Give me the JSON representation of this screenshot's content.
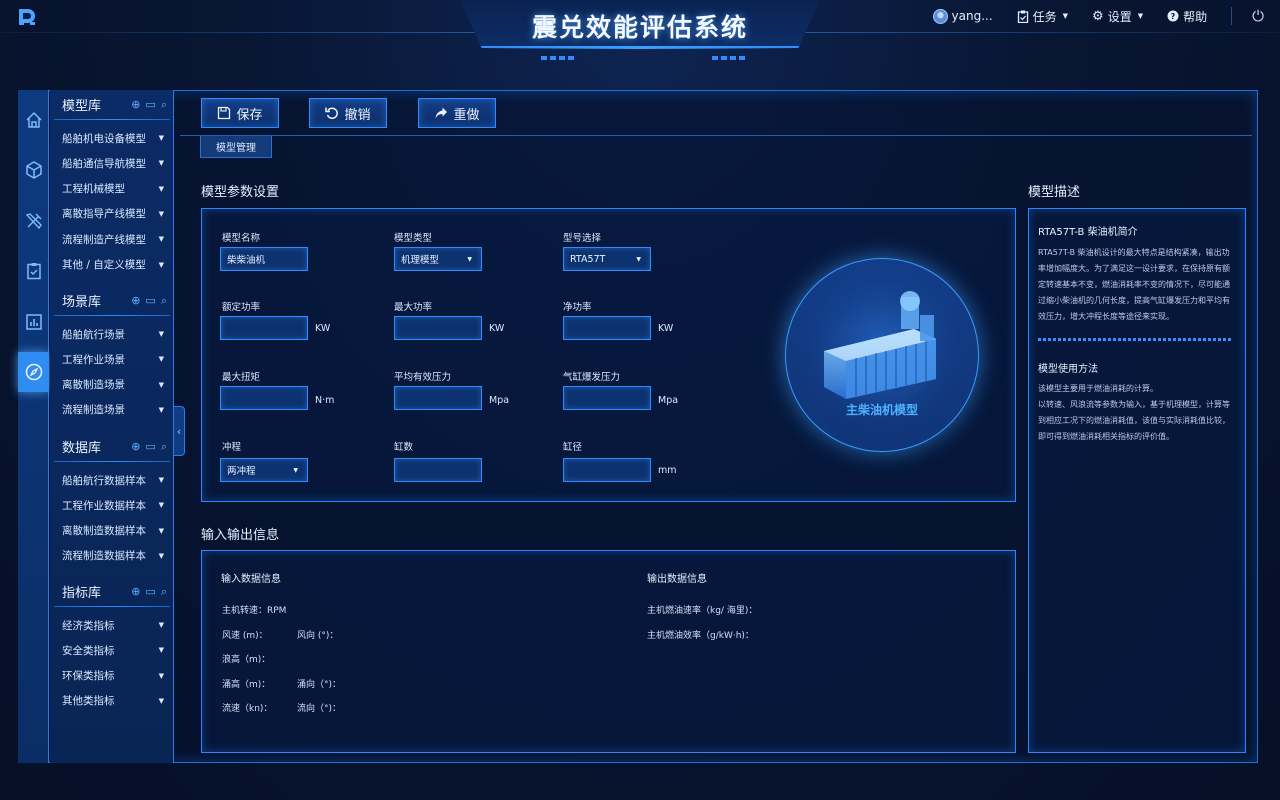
{
  "header": {
    "title": "震兑效能评估系统",
    "user": "yang...",
    "tasks": "任务",
    "settings": "设置",
    "help": "帮助"
  },
  "libraries": [
    {
      "title": "模型库",
      "items": [
        "船舶机电设备模型",
        "船舶通信导航模型",
        "工程机械模型",
        "离散指导产线模型",
        "流程制造产线模型",
        "其他 / 自定义模型"
      ]
    },
    {
      "title": "场景库",
      "items": [
        "船舶航行场景",
        "工程作业场景",
        "离散制造场景",
        "流程制造场景"
      ]
    },
    {
      "title": "数据库",
      "items": [
        "船舶航行数据样本",
        "工程作业数据样本",
        "离散制造数据样本",
        "流程制造数据样本"
      ]
    },
    {
      "title": "指标库",
      "items": [
        "经济类指标",
        "安全类指标",
        "环保类指标",
        "其他类指标"
      ]
    }
  ],
  "toolbar": {
    "save": "保存",
    "undo": "撤销",
    "redo": "重做"
  },
  "tab": "模型管理",
  "params": {
    "title": "模型参数设置",
    "model_name": {
      "label": "模型名称",
      "value": "柴柴油机"
    },
    "model_type": {
      "label": "模型类型",
      "value": "机理模型"
    },
    "model_select": {
      "label": "型号选择",
      "value": "RTA57T"
    },
    "rated_power": {
      "label": "额定功率",
      "unit": "KW"
    },
    "max_power": {
      "label": "最大功率",
      "unit": "KW"
    },
    "net_power": {
      "label": "净功率",
      "unit": "KW"
    },
    "max_torque": {
      "label": "最大扭矩",
      "unit": "N·m"
    },
    "mean_pressure": {
      "label": "平均有效压力",
      "unit": "Mpa"
    },
    "burst_pressure": {
      "label": "气缸爆发压力",
      "unit": "Mpa"
    },
    "stroke": {
      "label": "冲程",
      "value": "两冲程"
    },
    "cylinders": {
      "label": "缸数"
    },
    "bore": {
      "label": "缸径",
      "unit": "mm"
    },
    "engine_label": "主柴油机模型"
  },
  "desc": {
    "title": "模型描述",
    "intro_title": "RTA57T-B 柴油机简介",
    "intro_lines": [
      "RTA57T-B 柴油机设计的最大特点是结构紧凑，输出功",
      "率增加幅度大。为了满足这一设计要求，在保持原有额",
      "定转速基本不变，燃油消耗率不变的情况下，尽可能通",
      "过缩小柴油机的几何长度，提高气缸爆发压力和平均有",
      "效压力，增大冲程长度等途径来实现。"
    ],
    "usage_title": "模型使用方法",
    "usage_lines": [
      "该模型主要用于燃油消耗的计算。",
      "以转速、风浪流等参数为输入，基于机理模型，计算等",
      "到相应工况下的燃油消耗值，该值与实际消耗值比较，",
      "即可得到燃油消耗相关指标的评价值。"
    ]
  },
  "io": {
    "title": "输入输出信息",
    "input_title": "输入数据信息",
    "output_title": "输出数据信息",
    "rpm": "主机转速：RPM",
    "wind_speed": "风速 (m)：",
    "wind_dir": "风向 (°)：",
    "wave_height": "浪高（m)：",
    "surge_height": "涌高（m)：",
    "surge_dir": "涌向（°)：",
    "current_speed": "流速（kn)：",
    "current_dir": "流向（°)：",
    "fuel_rate": "主机燃油速率（kg/ 海里)：",
    "fuel_eff": "主机燃油效率（g/kW·h)："
  }
}
